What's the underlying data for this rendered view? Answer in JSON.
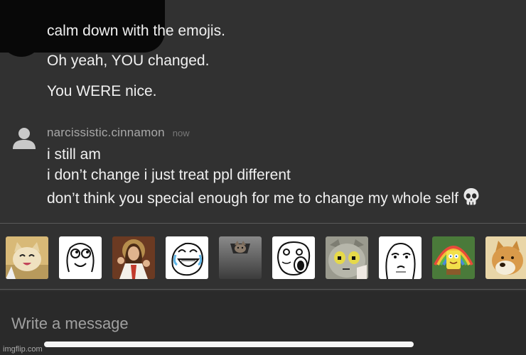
{
  "messages_prev": [
    "calm down with the emojis.",
    "Oh yeah, YOU changed.",
    "You WERE nice."
  ],
  "reply": {
    "author": "narcissistic.cinnamon",
    "time": "now",
    "lines": [
      "i still am",
      "i don’t change i just treat ppl different",
      "don’t think you special enough for me to change my whole self"
    ],
    "emoji": "skull-icon"
  },
  "stickers": [
    "happy-cat-sticker",
    "rage-face-sticker",
    "buddy-christ-sticker",
    "tears-of-joy-rage-face-sticker",
    "ceiling-cat-sticker",
    "lol-face-sticker",
    "unsettled-tom-sticker",
    "okay-guy-sticker",
    "imagination-spongebob-sticker",
    "doge-sticker"
  ],
  "composer": {
    "placeholder": "Write a message"
  },
  "watermark": "imgflip.com"
}
